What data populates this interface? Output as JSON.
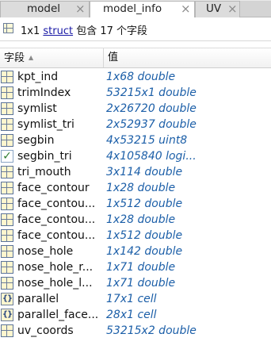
{
  "tabs": [
    {
      "label": "model",
      "active": false
    },
    {
      "label": "model_info",
      "active": true
    },
    {
      "label": "UV",
      "active": false
    }
  ],
  "tab_close_glyph": "×",
  "info": {
    "prefix": "1x1 ",
    "link": "struct",
    "suffix": " 包含 17 个字段"
  },
  "columns": {
    "field": "字段",
    "value": "值"
  },
  "sort_indicator": "▲",
  "rows": [
    {
      "icon": "grid-icon",
      "name": "kpt_ind",
      "value": "1x68 double"
    },
    {
      "icon": "grid-icon",
      "name": "trimIndex",
      "value": "53215x1 double"
    },
    {
      "icon": "grid-icon",
      "name": "symlist",
      "value": "2x26720 double"
    },
    {
      "icon": "grid-icon",
      "name": "symlist_tri",
      "value": "2x52937 double"
    },
    {
      "icon": "grid-icon",
      "name": "segbin",
      "value": "4x53215 uint8"
    },
    {
      "icon": "checkbox-icon",
      "name": "segbin_tri",
      "value": "4x105840 logi..."
    },
    {
      "icon": "grid-icon",
      "name": "tri_mouth",
      "value": "3x114 double"
    },
    {
      "icon": "grid-icon",
      "name": "face_contour",
      "value": "1x28 double"
    },
    {
      "icon": "grid-icon",
      "name": "face_contou...",
      "value": "1x512 double"
    },
    {
      "icon": "grid-icon",
      "name": "face_contou...",
      "value": "1x28 double"
    },
    {
      "icon": "grid-icon",
      "name": "face_contou...",
      "value": "1x512 double"
    },
    {
      "icon": "grid-icon",
      "name": "nose_hole",
      "value": "1x142 double"
    },
    {
      "icon": "grid-icon",
      "name": "nose_hole_r...",
      "value": "1x71 double"
    },
    {
      "icon": "grid-icon",
      "name": "nose_hole_l...",
      "value": "1x71 double"
    },
    {
      "icon": "cell-icon",
      "name": "parallel",
      "value": "17x1 cell"
    },
    {
      "icon": "cell-icon",
      "name": "parallel_face...",
      "value": "28x1 cell"
    },
    {
      "icon": "grid-icon",
      "name": "uv_coords",
      "value": "53215x2 double"
    }
  ],
  "colors": {
    "value_text": "#1c5fa8",
    "link": "#1a1aa6",
    "header_bg": "#f1f1f1",
    "tabbar_bg": "#e9e9e9"
  }
}
